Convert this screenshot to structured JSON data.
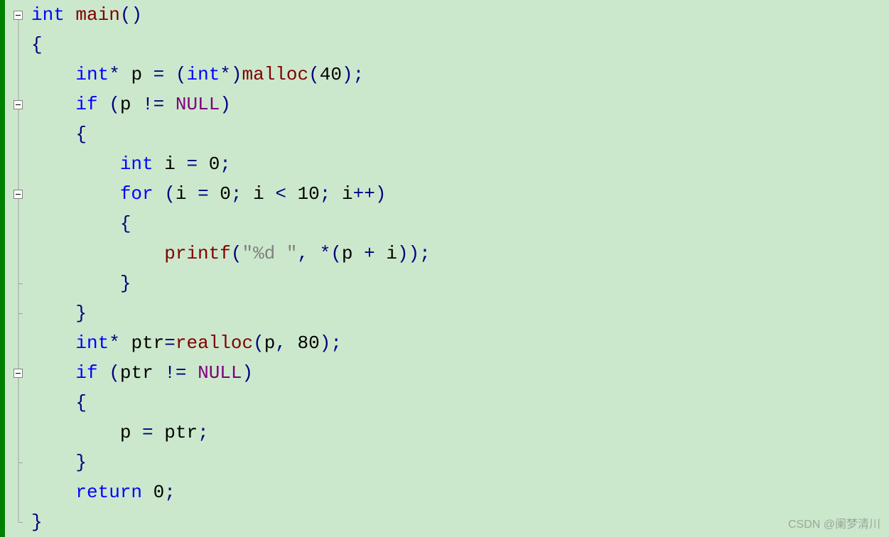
{
  "code": {
    "line1": {
      "t1": "int",
      "t2": " ",
      "t3": "main",
      "t4": "()"
    },
    "line2": {
      "t1": "{"
    },
    "line3": {
      "t1": "    ",
      "t2": "int",
      "t3": "* ",
      "t4": "p ",
      "t5": "= (",
      "t6": "int",
      "t7": "*)",
      "t8": "malloc",
      "t9": "(",
      "t10": "40",
      "t11": ");"
    },
    "line4": {
      "t1": "    ",
      "t2": "if",
      "t3": " (",
      "t4": "p ",
      "t5": "!= ",
      "t6": "NULL",
      "t7": ")"
    },
    "line5": {
      "t1": "    {"
    },
    "line6": {
      "t1": "        ",
      "t2": "int",
      "t3": " ",
      "t4": "i ",
      "t5": "= ",
      "t6": "0",
      "t7": ";"
    },
    "line7": {
      "t1": "        ",
      "t2": "for",
      "t3": " (",
      "t4": "i ",
      "t5": "= ",
      "t6": "0",
      "t7": "; ",
      "t8": "i ",
      "t9": "< ",
      "t10": "10",
      "t11": "; ",
      "t12": "i",
      "t13": "++)"
    },
    "line8": {
      "t1": "        {"
    },
    "line9": {
      "t1": "            ",
      "t2": "printf",
      "t3": "(",
      "t4": "\"%d \"",
      "t5": ", *(",
      "t6": "p ",
      "t7": "+ ",
      "t8": "i",
      "t9": "));"
    },
    "line10": {
      "t1": "        }"
    },
    "line11": {
      "t1": "    }"
    },
    "line12": {
      "t1": "    ",
      "t2": "int",
      "t3": "* ",
      "t4": "ptr",
      "t5": "=",
      "t6": "realloc",
      "t7": "(",
      "t8": "p",
      "t9": ", ",
      "t10": "80",
      "t11": ");"
    },
    "line13": {
      "t1": "    ",
      "t2": "if",
      "t3": " (",
      "t4": "ptr ",
      "t5": "!= ",
      "t6": "NULL",
      "t7": ")"
    },
    "line14": {
      "t1": "    {"
    },
    "line15": {
      "t1": "        ",
      "t2": "p ",
      "t3": "= ",
      "t4": "ptr",
      "t5": ";"
    },
    "line16": {
      "t1": "    }"
    },
    "line17": {
      "t1": "    ",
      "t2": "return",
      "t3": " ",
      "t4": "0",
      "t5": ";"
    },
    "line18": {
      "t1": "}"
    }
  },
  "watermark": "CSDN @阑梦清川"
}
